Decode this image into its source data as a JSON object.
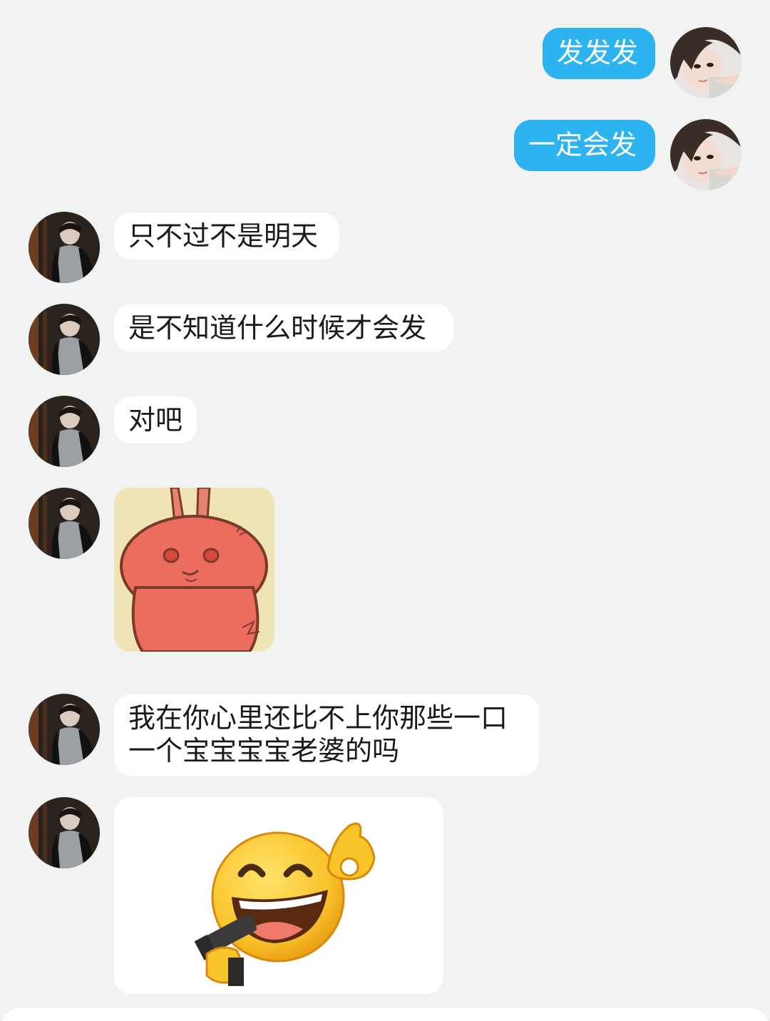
{
  "messages": [
    {
      "side": "out",
      "text": "发发发"
    },
    {
      "side": "out",
      "text": "一定会发"
    },
    {
      "side": "in",
      "text": "只不过不是明天"
    },
    {
      "side": "in",
      "text": "是不知道什么时候才会发"
    },
    {
      "side": "in",
      "text": "对吧"
    },
    {
      "side": "in",
      "sticker": "rabbit-sticker"
    },
    {
      "side": "in",
      "line1": "我在你心里还比不上你那些一口",
      "line2": "一个宝宝宝宝老婆的吗"
    },
    {
      "side": "in",
      "sticker": "laughing-emoji-gun-sticker"
    }
  ],
  "colors": {
    "background": "#f0f3f2",
    "outgoing_bubble": "#2cb3f0",
    "incoming_bubble": "#ffffff"
  }
}
